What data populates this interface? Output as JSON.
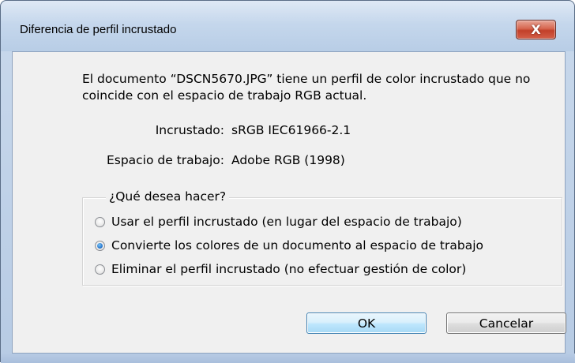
{
  "window": {
    "title": "Diferencia de perfil incrustado",
    "close_glyph": "X"
  },
  "message": {
    "text": "El documento “DSCN5670.JPG” tiene un perfil de color incrustado que no coincide con el espacio de trabajo RGB actual."
  },
  "info": {
    "embedded_label": "Incrustado:",
    "embedded_value": "sRGB IEC61966-2.1",
    "workspace_label": "Espacio de trabajo:",
    "workspace_value": "Adobe RGB (1998)"
  },
  "options": {
    "legend": "¿Qué desea hacer?",
    "items": [
      {
        "label": "Usar el perfil incrustado (en lugar del espacio de trabajo)",
        "checked": false
      },
      {
        "label": "Convierte los colores de un documento al espacio de trabajo",
        "checked": true
      },
      {
        "label": "Eliminar el perfil incrustado (no efectuar gestión de color)",
        "checked": false
      }
    ]
  },
  "buttons": {
    "ok": "OK",
    "cancel": "Cancelar"
  },
  "colors": {
    "title_bar": "#c5d7ec",
    "close_button": "#c2402a",
    "dialog_body": "#f0f0f0",
    "default_button_border": "#3c7fb1"
  },
  "icons": {
    "close": "close-icon",
    "radio_checked": "radio-checked-icon",
    "radio_unchecked": "radio-unchecked-icon"
  }
}
